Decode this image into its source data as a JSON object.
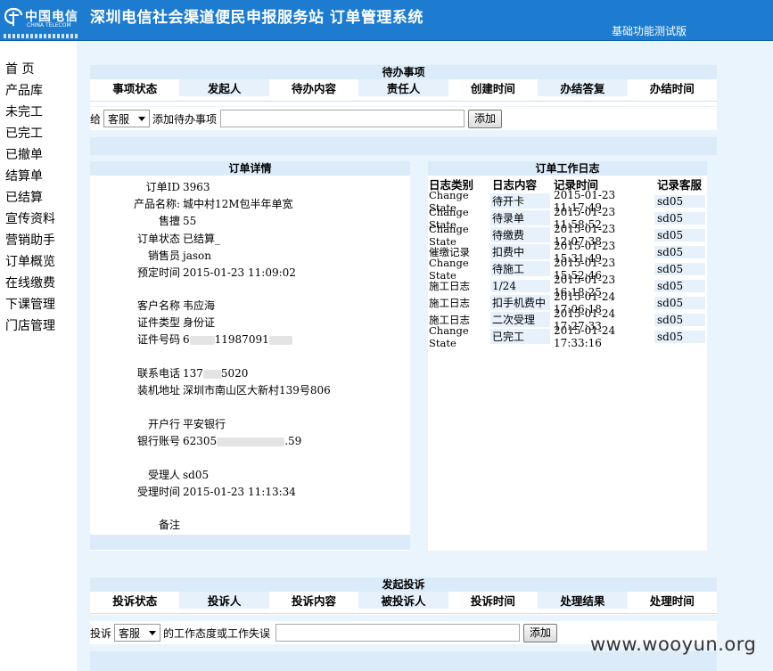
{
  "header": {
    "logo_cn": "中国电信",
    "logo_en": "CHINA TELECOM",
    "title": "深圳电信社会渠道便民申报服务站  订单管理系统",
    "version": "基础功能测试版"
  },
  "sidebar": {
    "items": [
      "首 页",
      "产品库",
      "未完工",
      "已完工",
      "已撤单",
      "结算单",
      "已结算",
      "宣传资料",
      "营销助手",
      "订单概览",
      "在线缴费",
      "下课管理",
      "门店管理"
    ]
  },
  "todo": {
    "title": "待办事项",
    "columns": [
      "事项状态",
      "发起人",
      "待办内容",
      "责任人",
      "创建时间",
      "办结答复",
      "办结时间"
    ],
    "add_prefix": "给",
    "select_value": "客服",
    "add_label": "添加待办事项",
    "add_button": "添加"
  },
  "detail": {
    "title": "订单详情",
    "fields": [
      {
        "label": "订单ID",
        "value": "3963"
      },
      {
        "label": "产品名称:",
        "value": "城中村12M包半年单宽"
      },
      {
        "label": "售擅",
        "value": "55"
      },
      {
        "label": "订单状态",
        "value": "已结算_"
      },
      {
        "label": "销售员",
        "value": "jason"
      },
      {
        "label": "预定时间",
        "value": "2015-01-23 11:09:02"
      },
      {
        "label": "客户名称",
        "value": "韦应海"
      },
      {
        "label": "证件类型",
        "value": "身份证"
      },
      {
        "label": "证件号码",
        "value": "6",
        "value2": "11987091"
      },
      {
        "label": "联系电话",
        "value": "137",
        "value2": "5020"
      },
      {
        "label": "装机地址",
        "value": "深圳市南山区大新村139号806"
      },
      {
        "label": "开户行",
        "value": "平安银行"
      },
      {
        "label": "银行账号",
        "value": "62305",
        "value2": ".59"
      },
      {
        "label": "受理人",
        "value": "sd05"
      },
      {
        "label": "受理时间",
        "value": "2015-01-23 11:13:34"
      },
      {
        "label": "备注",
        "value": ""
      }
    ]
  },
  "log": {
    "title": "订单工作日志",
    "columns": [
      "日志类别",
      "日志内容",
      "记录时间",
      "记录客服"
    ],
    "rows": [
      [
        "Change State",
        "待开卡",
        "2015-01-23 11:17:49",
        "sd05"
      ],
      [
        "Change State",
        "待录单",
        "2015-01-23 11:58:52",
        "sd05"
      ],
      [
        "Change State",
        "待缴费",
        "2015-01-23 12:07:38",
        "sd05"
      ],
      [
        "催缴记录",
        "扣费中",
        "2015-01-23 15:31:49",
        "sd05"
      ],
      [
        "Change State",
        "待施工",
        "2015-01-23 15:52:46",
        "sd05"
      ],
      [
        "施工日志",
        "1/24",
        "2015-01-23 16:18:25",
        "sd05"
      ],
      [
        "施工日志",
        "扣手机费中",
        "2015-01-24 17:06:18",
        "sd05"
      ],
      [
        "施工日志",
        "二次受理",
        "2015-01-24 17:27:33",
        "sd05"
      ],
      [
        "Change State",
        "已完工",
        "2015-01-24 17:33:16",
        "sd05"
      ]
    ]
  },
  "complaint": {
    "title": "发起投诉",
    "columns": [
      "投诉状态",
      "投诉人",
      "投诉内容",
      "被投诉人",
      "投诉时间",
      "处理结果",
      "处理时间"
    ],
    "prefix": "投诉",
    "select_value": "客服",
    "label": "的工作态度或工作失误",
    "button": "添加"
  },
  "watermark": "www.wooyun.org"
}
